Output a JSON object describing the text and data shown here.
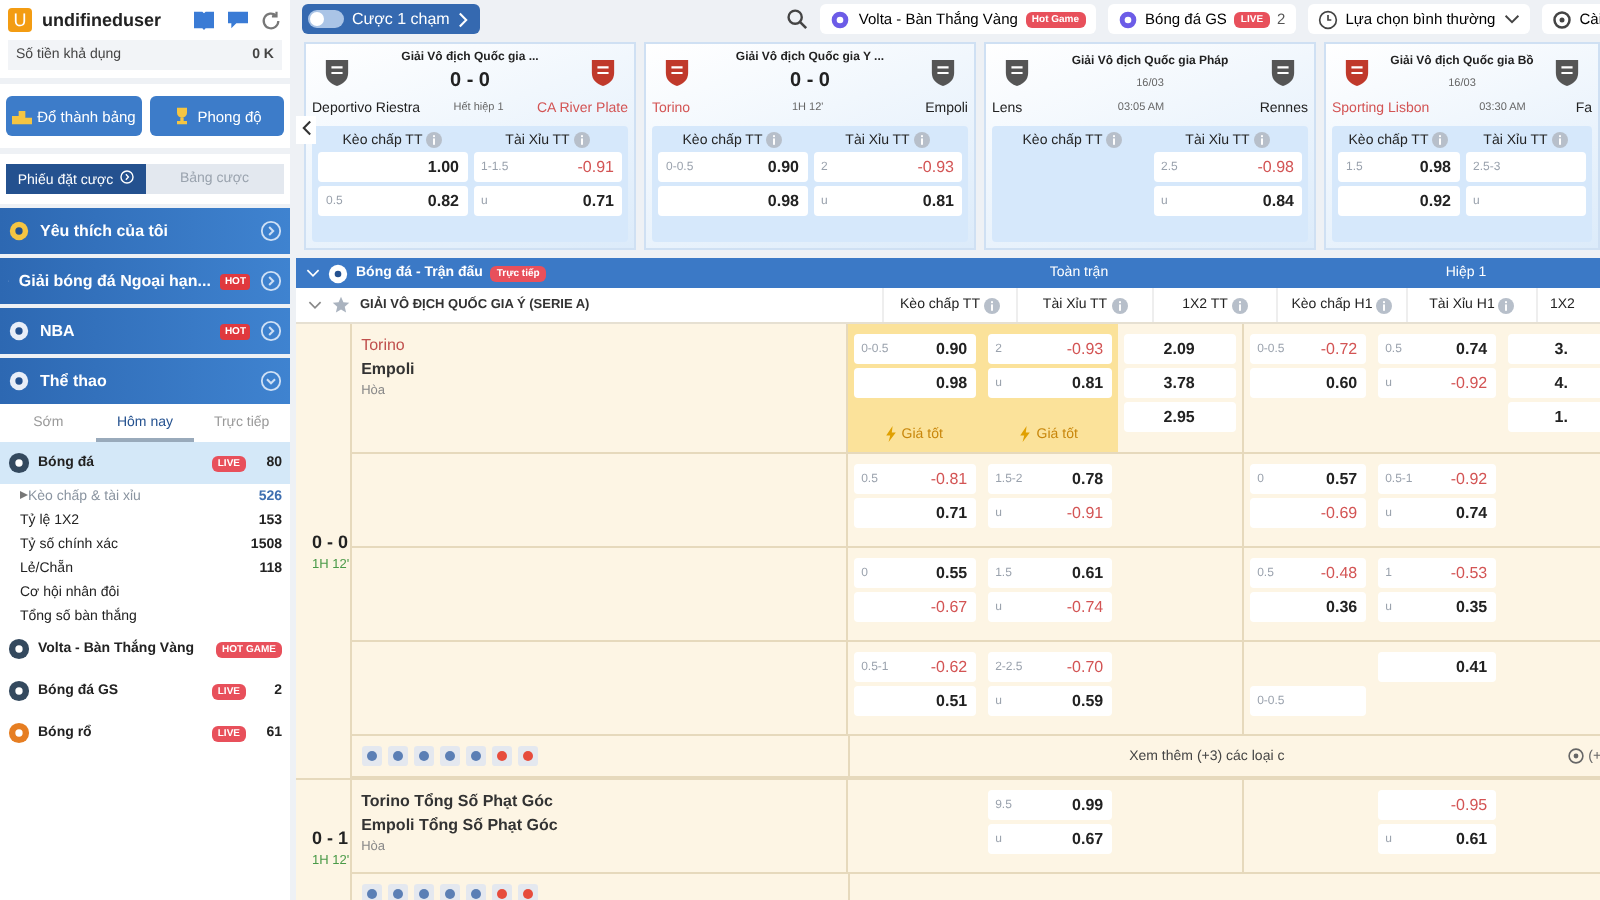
{
  "user": {
    "avatar_letter": "U",
    "name": "undifineduser",
    "balance_label": "Số tiền khả dụng",
    "balance": "0 K"
  },
  "quick_buttons": [
    "Đổ thành bảng",
    "Phong độ"
  ],
  "bet_tabs": [
    {
      "label": "Phiếu đặt cược",
      "selected": true
    },
    {
      "label": "Bảng cược",
      "selected": false
    }
  ],
  "menu": [
    {
      "label": "Yêu thích của tôi",
      "expanded": false
    },
    {
      "label": "Giải bóng đá Ngoại hạn...",
      "badge": "HOT",
      "expanded": false
    },
    {
      "label": "NBA",
      "badge": "HOT",
      "expanded": false
    },
    {
      "label": "Thể thao",
      "expanded": true
    }
  ],
  "period_tabs": [
    {
      "label": "Sớm",
      "selected": false
    },
    {
      "label": "Hôm nay",
      "selected": true
    },
    {
      "label": "Trực tiếp",
      "selected": false
    }
  ],
  "sports": [
    {
      "label": "Bóng đá",
      "badge": "LIVE",
      "count": "80",
      "selected": true,
      "children": [
        {
          "label": "Kèo chấp & tài xỉu",
          "count": "526",
          "selected": true
        },
        {
          "label": "Tỷ lệ 1X2",
          "count": "153",
          "selected": false
        },
        {
          "label": "Tỷ số chính xác",
          "count": "1508",
          "selected": false
        },
        {
          "label": "Lẻ/Chẵn",
          "count": "118",
          "selected": false
        },
        {
          "label": "Cơ hội nhân đôi",
          "selected": false
        },
        {
          "label": "Tổng số bàn thắng",
          "selected": false
        }
      ]
    },
    {
      "label": "Volta - Bàn Thắng Vàng",
      "badge": "HOT GAME",
      "selected": false
    },
    {
      "label": "Bóng đá GS",
      "badge": "LIVE",
      "count": "2",
      "selected": false
    },
    {
      "label": "Bóng rổ",
      "badge": "LIVE",
      "count": "61",
      "selected": false
    }
  ],
  "top_bar": {
    "one_click": {
      "label": "Cược 1 chạm",
      "on": false
    },
    "tabs": [
      {
        "label": "Volta - Bàn Thắng Vàng",
        "badge": "Hot Game"
      },
      {
        "label": "Bóng đá GS",
        "badge": "LIVE",
        "count": "2"
      }
    ],
    "select": {
      "label": "Lựa chọn bình thường"
    },
    "settings": {
      "label": "Cài"
    }
  },
  "cards": [
    {
      "league": "Giải Vô địch Quốc gia ...",
      "teams": [
        {
          "name": "Deportivo Riestra",
          "favored": false
        },
        {
          "name": "CA River Plate",
          "favored": true
        }
      ],
      "score": "0 - 0",
      "status": "Hết hiệp 1",
      "markets": [
        {
          "title": "Kèo chấp TT",
          "odds": [
            {
              "odds": "1.00"
            },
            {
              "line": "0.5",
              "odds": "0.82"
            }
          ]
        },
        {
          "title": "Tài Xỉu TT",
          "odds": [
            {
              "line": "1-1.5",
              "odds": "-0.91"
            },
            {
              "line": "u",
              "odds": "0.71"
            }
          ]
        }
      ]
    },
    {
      "league": "Giải Vô địch Quốc gia Y ...",
      "teams": [
        {
          "name": "Torino",
          "favored": true
        },
        {
          "name": "Empoli",
          "favored": false
        }
      ],
      "score": "0 - 0",
      "status": "1H 12'",
      "markets": [
        {
          "title": "Kèo chấp TT",
          "odds": [
            {
              "line": "0-0.5",
              "odds": "0.90"
            },
            {
              "odds": "0.98"
            }
          ]
        },
        {
          "title": "Tài Xỉu TT",
          "odds": [
            {
              "line": "2",
              "odds": "-0.93"
            },
            {
              "line": "u",
              "odds": "0.81"
            }
          ]
        }
      ]
    },
    {
      "league": "Giải Vô địch Quốc gia Pháp",
      "teams": [
        {
          "name": "Lens",
          "favored": false
        },
        {
          "name": "Rennes",
          "favored": false
        }
      ],
      "date": "16/03",
      "status": "03:05 AM",
      "markets": [
        {
          "title": "Kèo chấp TT"
        },
        {
          "title": "Tài Xỉu TT",
          "odds": [
            {
              "line": "2.5",
              "odds": "-0.98"
            },
            {
              "line": "u",
              "odds": "0.84"
            }
          ]
        }
      ]
    },
    {
      "league": "Giải Vô địch Quốc gia Bồ",
      "teams": [
        {
          "name": "Sporting Lisbon",
          "favored": true
        },
        {
          "name": "Fa",
          "favored": false
        }
      ],
      "date": "16/03",
      "status": "03:30 AM",
      "markets": [
        {
          "title": "Kèo chấp TT",
          "odds": [
            {
              "line": "1.5",
              "odds": "0.98"
            },
            {
              "odds": "0.92"
            }
          ]
        },
        {
          "title": "Tài Xỉu TT",
          "odds": [
            {
              "line": "2.5-3"
            },
            {
              "line": "u"
            }
          ]
        }
      ]
    }
  ],
  "table": {
    "section": "Bóng đá - Trận đấu",
    "section_badge": "Trực tiếp",
    "groups": [
      "Toàn trận",
      "Hiệp 1"
    ],
    "league": "GIẢI VÔ ĐỊCH QUỐC GIA Ý (SERIE A)",
    "columns": [
      "Kèo chấp TT",
      "Tài Xỉu TT",
      "1X2 TT",
      "Kèo chấp H1",
      "Tài Xỉu H1",
      "1X2"
    ],
    "matches": [
      {
        "score": "0 - 0",
        "time": "1H 12'",
        "teams": [
          {
            "name": "Torino",
            "favored": true
          },
          {
            "name": "Empoli",
            "favored": false
          }
        ],
        "draw": "Hòa",
        "more": "Xem thêm (+3) các loại c",
        "more_right": "(+",
        "rows": [
          {
            "kc_tt": {
              "odds": [
                {
                  "line": "0-0.5",
                  "odds": "0.90"
                },
                {
                  "odds": "0.98"
                }
              ],
              "tag": "Giá tốt"
            },
            "tx_tt": {
              "odds": [
                {
                  "line": "2",
                  "odds": "-0.93"
                },
                {
                  "line": "u",
                  "odds": "0.81"
                }
              ],
              "tag": "Giá tốt"
            },
            "x12_tt": [
              "2.09",
              "3.78",
              "2.95"
            ],
            "kc_h1": {
              "odds": [
                {
                  "line": "0-0.5",
                  "odds": "-0.72"
                },
                {
                  "odds": "0.60"
                }
              ]
            },
            "tx_h1": {
              "odds": [
                {
                  "line": "0.5",
                  "odds": "0.74"
                },
                {
                  "line": "u",
                  "odds": "-0.92"
                }
              ]
            },
            "x12_h1": [
              "3.",
              "4.",
              "1."
            ]
          },
          {
            "kc_tt": {
              "odds": [
                {
                  "line": "0.5",
                  "odds": "-0.81"
                },
                {
                  "odds": "0.71"
                }
              ]
            },
            "tx_tt": {
              "odds": [
                {
                  "line": "1.5-2",
                  "odds": "0.78"
                },
                {
                  "line": "u",
                  "odds": "-0.91"
                }
              ]
            },
            "kc_h1": {
              "odds": [
                {
                  "line": "0",
                  "odds": "0.57"
                },
                {
                  "odds": "-0.69"
                }
              ]
            },
            "tx_h1": {
              "odds": [
                {
                  "line": "0.5-1",
                  "odds": "-0.92"
                },
                {
                  "line": "u",
                  "odds": "0.74"
                }
              ]
            }
          },
          {
            "kc_tt": {
              "odds": [
                {
                  "line": "0",
                  "odds": "0.55"
                },
                {
                  "odds": "-0.67"
                }
              ]
            },
            "tx_tt": {
              "odds": [
                {
                  "line": "1.5",
                  "odds": "0.61"
                },
                {
                  "line": "u",
                  "odds": "-0.74"
                }
              ]
            },
            "kc_h1": {
              "odds": [
                {
                  "line": "0.5",
                  "odds": "-0.48"
                },
                {
                  "odds": "0.36"
                }
              ]
            },
            "tx_h1": {
              "odds": [
                {
                  "line": "1",
                  "odds": "-0.53"
                },
                {
                  "line": "u",
                  "odds": "0.35"
                }
              ]
            }
          },
          {
            "kc_tt": {
              "odds": [
                {
                  "line": "0.5-1",
                  "odds": "-0.62"
                },
                {
                  "odds": "0.51"
                }
              ]
            },
            "tx_tt": {
              "odds": [
                {
                  "line": "2-2.5",
                  "odds": "-0.70"
                },
                {
                  "line": "u",
                  "odds": "0.59"
                }
              ]
            },
            "kc_h1": {
              "odds": [
                {
                  "line": "0-0.5",
                  "lower": true
                }
              ]
            },
            "tx_h1": {
              "odds": [
                {
                  "odds": "0.41"
                }
              ]
            }
          }
        ]
      },
      {
        "score": "0 - 1",
        "time": "1H 12'",
        "teams": [
          {
            "name": "Torino Tổng Số Phạt Góc",
            "favored": false
          },
          {
            "name": "Empoli Tổng Số Phạt Góc",
            "favored": false
          }
        ],
        "draw": "Hòa",
        "rows": [
          {
            "tx_tt": {
              "odds": [
                {
                  "line": "9.5",
                  "odds": "0.99"
                },
                {
                  "line": "u",
                  "odds": "0.67"
                }
              ]
            },
            "tx_h1": {
              "odds": [
                {
                  "odds": "-0.95"
                },
                {
                  "line": "u",
                  "odds": "0.61"
                }
              ]
            }
          }
        ]
      }
    ]
  }
}
